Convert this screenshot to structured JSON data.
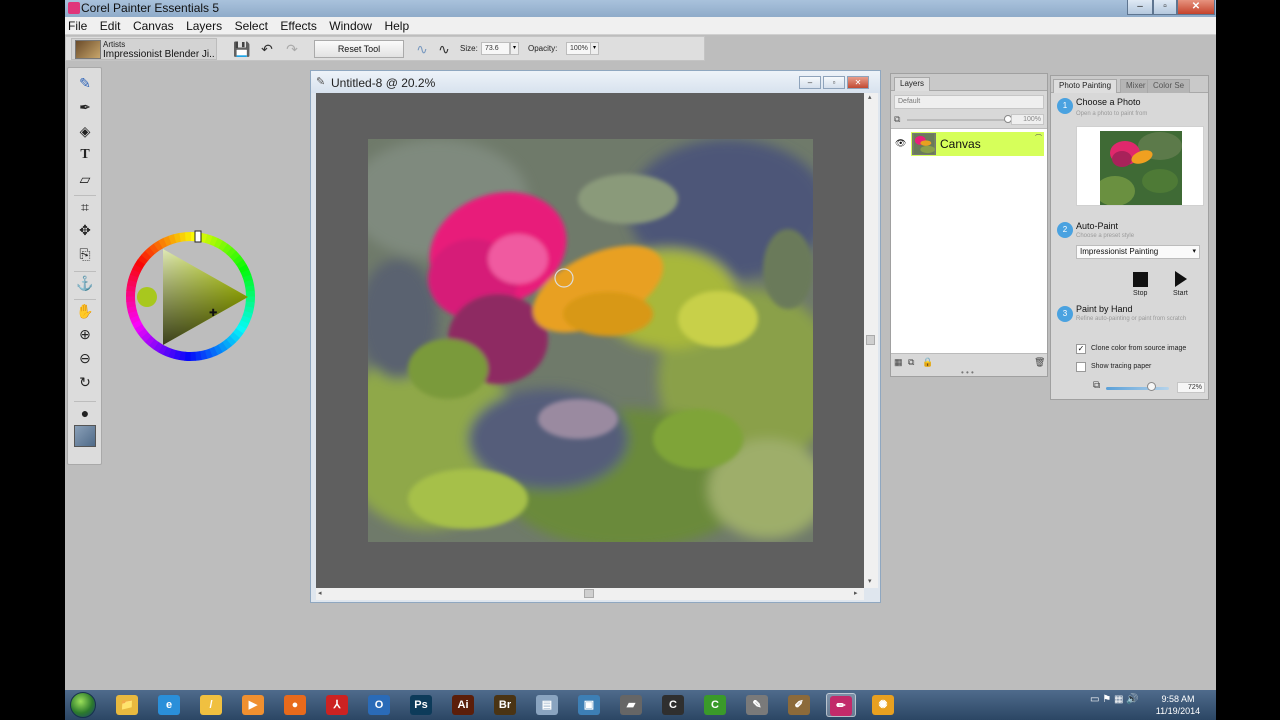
{
  "window": {
    "title": "Corel Painter Essentials 5",
    "min_glyph": "–",
    "max_glyph": "▫",
    "close_glyph": "✕"
  },
  "menu": [
    "File",
    "Edit",
    "Canvas",
    "Layers",
    "Select",
    "Effects",
    "Window",
    "Help"
  ],
  "property_bar": {
    "brush_category": "Artists",
    "brush_variant": "Impressionist Blender Ji...",
    "reset_label": "Reset Tool",
    "size_label": "Size:",
    "size_value": "73.6",
    "opacity_label": "Opacity:",
    "opacity_value": "100%"
  },
  "document": {
    "title": "Untitled-8 @ 20.2%",
    "painting_icon": "impressionist-flower-painting"
  },
  "layers_panel": {
    "tab": "Layers",
    "composite_method": "Default",
    "opacity": "100%",
    "layers": [
      {
        "name": "Canvas",
        "visible": true,
        "selected": true
      }
    ]
  },
  "photo_panel": {
    "tabs": [
      "Photo Painting",
      "Mixer",
      "Color Se"
    ],
    "step1": {
      "num": "1",
      "title": "Choose a Photo",
      "subtitle": "Open a photo to paint from"
    },
    "step2": {
      "num": "2",
      "title": "Auto-Paint",
      "subtitle": "Choose a preset style"
    },
    "preset": "Impressionist Painting",
    "stop_label": "Stop",
    "start_label": "Start",
    "step3": {
      "num": "3",
      "title": "Paint by Hand",
      "subtitle": "Refine auto-painting or paint from scratch"
    },
    "clone_color_label": "Clone color from source image",
    "clone_color_checked": true,
    "tracing_label": "Show tracing paper",
    "tracing_checked": false,
    "tracing_value": "72%",
    "tracing_fraction": 0.72
  },
  "color": {
    "selected_hex": "#a8c81e"
  },
  "taskbar": {
    "apps": [
      {
        "name": "file-explorer",
        "glyph": "📁",
        "color": "#e8b93f"
      },
      {
        "name": "internet-explorer",
        "glyph": "e",
        "color": "#2a8fd9"
      },
      {
        "name": "pen-app",
        "glyph": "/",
        "color": "#f0c040"
      },
      {
        "name": "media-player",
        "glyph": "▶",
        "color": "#f09030"
      },
      {
        "name": "firefox",
        "glyph": "●",
        "color": "#e86a1c"
      },
      {
        "name": "acrobat",
        "glyph": "⅄",
        "color": "#cc2222"
      },
      {
        "name": "outlook",
        "glyph": "O",
        "color": "#2a6bb8"
      },
      {
        "name": "photoshop",
        "glyph": "Ps",
        "color": "#0d3b5a"
      },
      {
        "name": "illustrator",
        "glyph": "Ai",
        "color": "#5b1e0a"
      },
      {
        "name": "bridge",
        "glyph": "Br",
        "color": "#4a3414"
      },
      {
        "name": "notepad",
        "glyph": "▤",
        "color": "#8aa4c0"
      },
      {
        "name": "screen-app",
        "glyph": "▣",
        "color": "#3d7fb5"
      },
      {
        "name": "eraser-app",
        "glyph": "▰",
        "color": "#666"
      },
      {
        "name": "camtasia-recorder",
        "glyph": "C",
        "color": "#2f2f2f"
      },
      {
        "name": "camtasia-studio",
        "glyph": "C",
        "color": "#3a9a2a"
      },
      {
        "name": "paint-app",
        "glyph": "✎",
        "color": "#7a7a7a"
      },
      {
        "name": "brush-app",
        "glyph": "✐",
        "color": "#8c6a3a"
      },
      {
        "name": "corel-painter",
        "glyph": "✏",
        "color": "#c22a6a"
      },
      {
        "name": "sun-app",
        "glyph": "✺",
        "color": "#e8a020"
      }
    ],
    "time": "9:58 AM",
    "date": "11/19/2014"
  }
}
